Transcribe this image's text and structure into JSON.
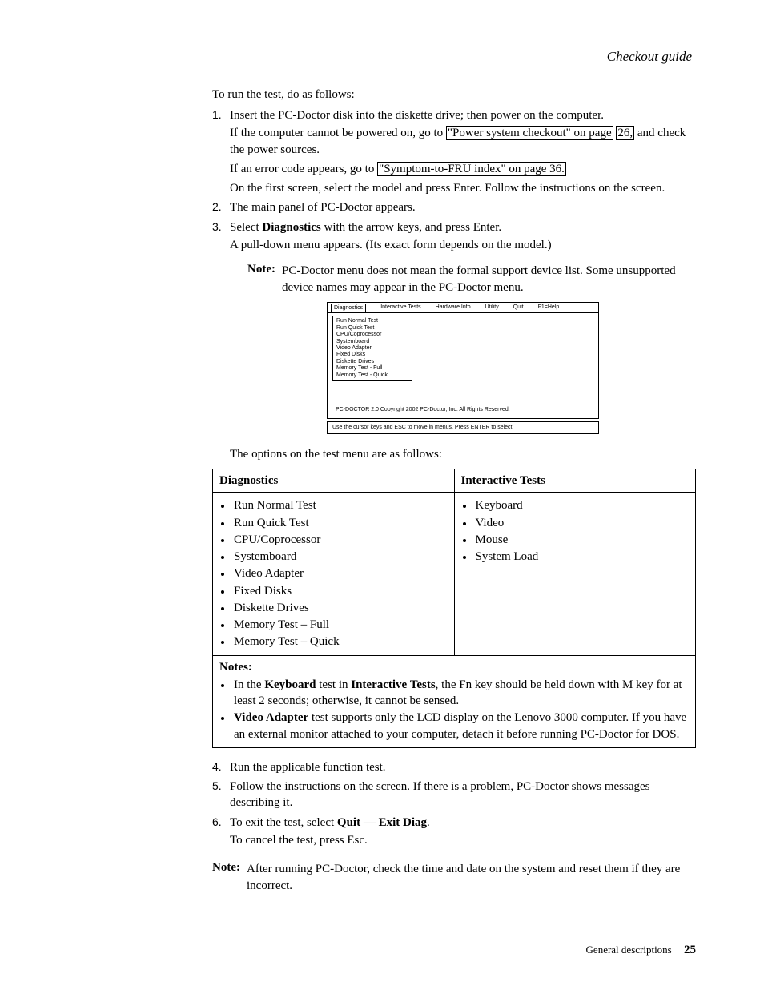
{
  "header": "Checkout guide",
  "intro": "To run the test, do as follows:",
  "steps": {
    "s1a": "Insert the PC-Doctor disk into the diskette drive; then power on the computer.",
    "s1b_pre": "If the computer cannot be powered on, go to ",
    "s1b_link1": "\"Power system checkout\" on page",
    "s1b_link2": "26,",
    "s1b_post": " and check the power sources.",
    "s1c_pre": "If an error code appears, go to ",
    "s1c_link": "\"Symptom-to-FRU index\" on page 36.",
    "s1d": "On the first screen, select the model and press Enter. Follow the instructions on the screen.",
    "s2": "The main panel of PC-Doctor appears.",
    "s3a_pre": "Select ",
    "s3a_bold": "Diagnostics",
    "s3a_post": " with the arrow keys, and press Enter.",
    "s3b": "A pull-down menu appears. (Its exact form depends on the model.)"
  },
  "note1": {
    "label": "Note:",
    "text": "PC-Doctor menu does not mean the formal support device list. Some unsupported device names may appear in the PC-Doctor menu."
  },
  "figure": {
    "menubar": [
      "Diagnostics",
      "Interactive Tests",
      "Hardware Info",
      "Utility",
      "Quit",
      "F1=Help"
    ],
    "dropdown": [
      "Run Normal Test",
      "Run Quick Test",
      "CPU/Coprocessor",
      "Systemboard",
      "Video Adapter",
      "Fixed Disks",
      "Diskette Drives",
      "Memory Test - Full",
      "Memory Test - Quick"
    ],
    "copyright": "PC-DOCTOR 2.0   Copyright 2002 PC-Doctor, Inc.   All Rights Reserved.",
    "status": "Use the cursor keys and ESC to move in menus.  Press ENTER to select."
  },
  "options_intro": "The options on the test menu are as follows:",
  "table": {
    "h1": "Diagnostics",
    "h2": "Interactive Tests",
    "col1": [
      "Run Normal Test",
      "Run Quick Test",
      "CPU/Coprocessor",
      "Systemboard",
      "Video Adapter",
      "Fixed Disks",
      "Diskette Drives",
      "Memory Test – Full",
      "Memory Test – Quick"
    ],
    "col2": [
      "Keyboard",
      "Video",
      "Mouse",
      "System Load"
    ],
    "notes_label": "Notes:",
    "note_a_pre": "In the ",
    "note_a_b1": "Keyboard",
    "note_a_mid": " test in ",
    "note_a_b2": "Interactive Tests",
    "note_a_post": ", the Fn key should be held down with M key for at least 2 seconds; otherwise, it cannot be sensed.",
    "note_b_b1": "Video Adapter",
    "note_b_post": " test supports only the LCD display on the Lenovo 3000 computer. If you have an external monitor attached to your computer, detach it before running PC-Doctor for DOS."
  },
  "steps2": {
    "s4": "Run the applicable function test.",
    "s5": "Follow the instructions on the screen. If there is a problem, PC-Doctor shows messages describing it.",
    "s6a_pre": "To exit the test, select ",
    "s6a_bold": "Quit — Exit Diag",
    "s6a_post": ".",
    "s6b": "To cancel the test, press Esc."
  },
  "note2": {
    "label": "Note:",
    "text": "After running PC-Doctor, check the time and date on the system and reset them if they are incorrect."
  },
  "footer": {
    "text": "General descriptions",
    "page": "25"
  }
}
